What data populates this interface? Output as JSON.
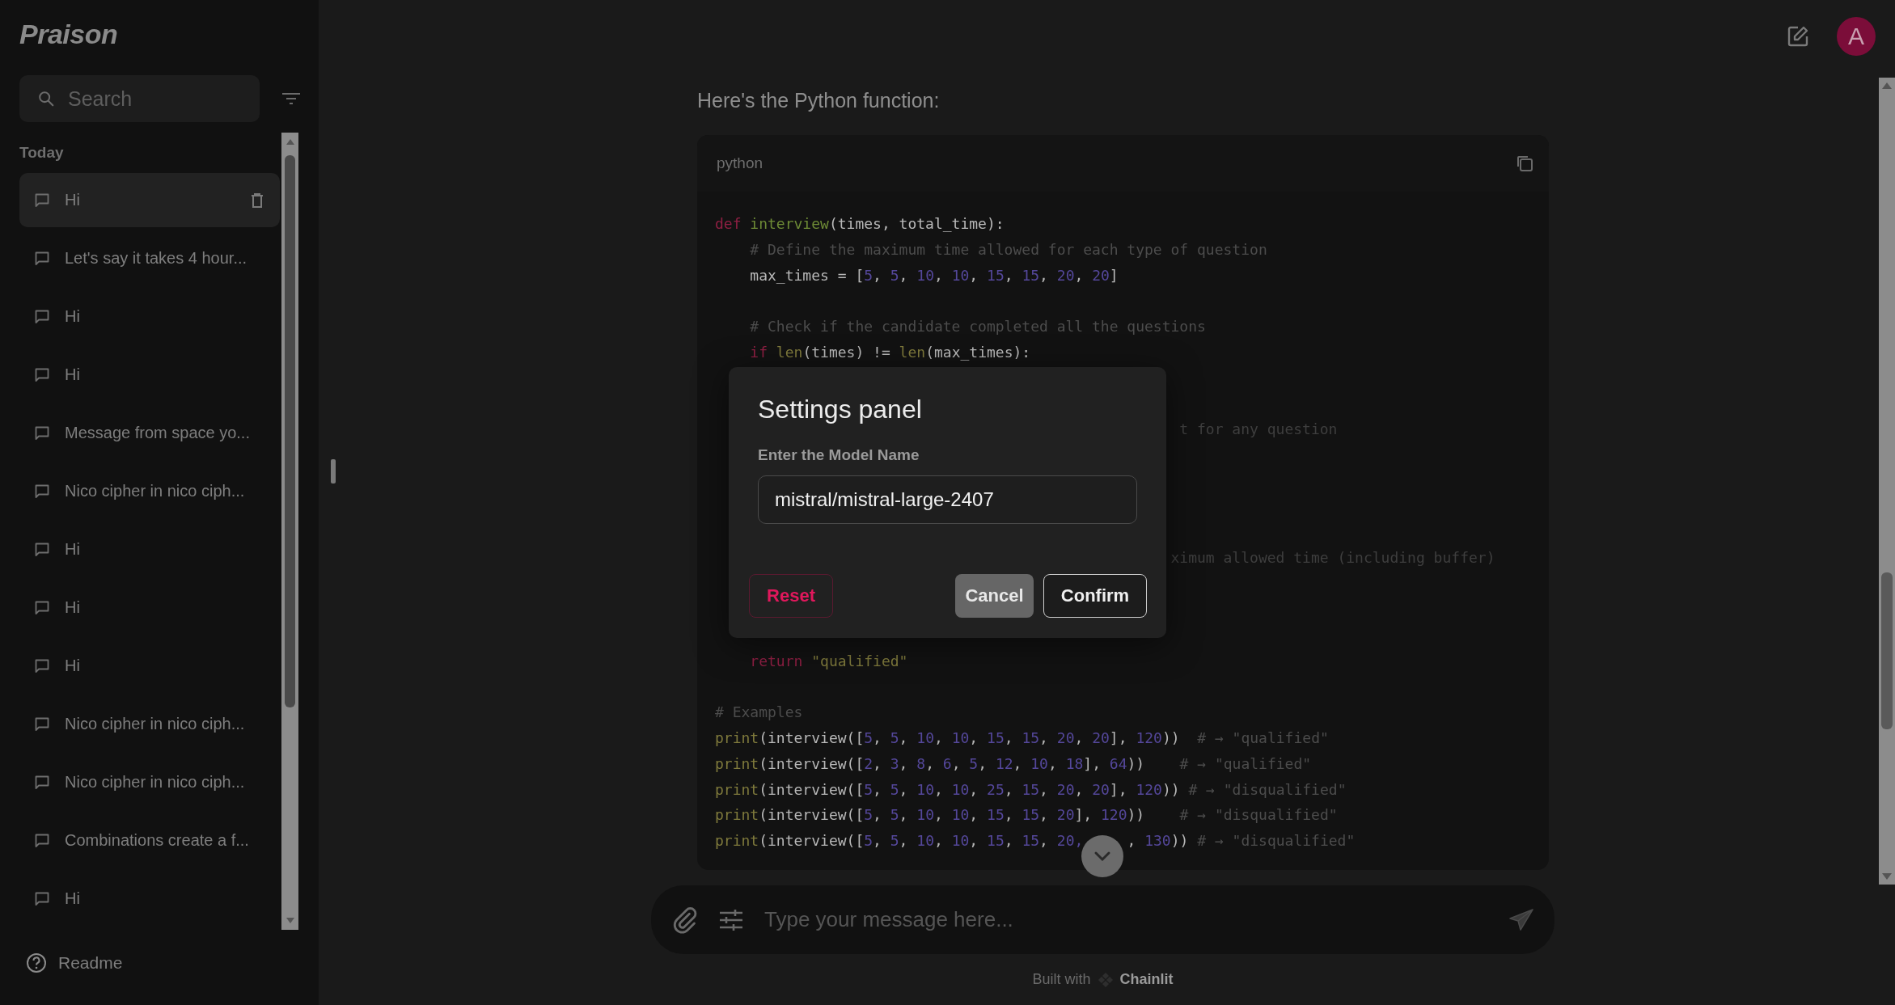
{
  "sidebar": {
    "logo": "Praison",
    "search": {
      "placeholder": "Search"
    },
    "group_label": "Today",
    "items": [
      {
        "label": "Hi",
        "selected": true
      },
      {
        "label": "Let's say it takes 4 hour...",
        "selected": false
      },
      {
        "label": "Hi",
        "selected": false
      },
      {
        "label": "Hi",
        "selected": false
      },
      {
        "label": "Message from space yo...",
        "selected": false
      },
      {
        "label": "Nico cipher in nico ciph...",
        "selected": false
      },
      {
        "label": "Hi",
        "selected": false
      },
      {
        "label": "Hi",
        "selected": false
      },
      {
        "label": "Hi",
        "selected": false
      },
      {
        "label": "Nico cipher in nico ciph...",
        "selected": false
      },
      {
        "label": "Nico cipher in nico ciph...",
        "selected": false
      },
      {
        "label": "Combinations create a f...",
        "selected": false
      },
      {
        "label": "Hi",
        "selected": false
      }
    ],
    "footer_link": "Readme"
  },
  "header": {
    "avatar": "A"
  },
  "message": {
    "text": "Here's the Python function:",
    "code": {
      "language": "python",
      "lines": [
        {
          "kind": "top",
          "tokens": [
            {
              "t": "def",
              "kind": "kw"
            },
            {
              "t": " interview",
              "kind": "fn"
            },
            {
              "t": "(times, total_time):",
              "kind": "plain"
            }
          ]
        },
        {
          "kind": "body",
          "tokens": [
            {
              "t": "# Define the maximum time allowed for each type of question",
              "kind": "cm"
            }
          ]
        },
        {
          "kind": "body",
          "tokens": [
            {
              "t": "max_times = [",
              "kind": "plain"
            },
            {
              "t": "5",
              "kind": "num"
            },
            {
              "t": ", ",
              "kind": "plain"
            },
            {
              "t": "5",
              "kind": "num"
            },
            {
              "t": ", ",
              "kind": "plain"
            },
            {
              "t": "10",
              "kind": "num"
            },
            {
              "t": ", ",
              "kind": "plain"
            },
            {
              "t": "10",
              "kind": "num"
            },
            {
              "t": ", ",
              "kind": "plain"
            },
            {
              "t": "15",
              "kind": "num"
            },
            {
              "t": ", ",
              "kind": "plain"
            },
            {
              "t": "15",
              "kind": "num"
            },
            {
              "t": ", ",
              "kind": "plain"
            },
            {
              "t": "20",
              "kind": "num"
            },
            {
              "t": ", ",
              "kind": "plain"
            },
            {
              "t": "20",
              "kind": "num"
            },
            {
              "t": "]",
              "kind": "plain"
            }
          ]
        },
        {
          "kind": "blank"
        },
        {
          "kind": "body",
          "tokens": [
            {
              "t": "# Check if the candidate completed all the questions",
              "kind": "cm"
            }
          ]
        },
        {
          "kind": "body",
          "tokens": [
            {
              "t": "if",
              "kind": "kw"
            },
            {
              "t": " len",
              "kind": "bi"
            },
            {
              "t": "(times) != ",
              "kind": "plain"
            },
            {
              "t": "len",
              "kind": "bi"
            },
            {
              "t": "(max_times):",
              "kind": "plain"
            }
          ]
        },
        {
          "kind": "blank"
        },
        {
          "kind": "blank"
        },
        {
          "kind": "partial",
          "tokens": [
            {
              "t": "t for any question",
              "kind": "cm"
            }
          ]
        },
        {
          "kind": "blank"
        },
        {
          "kind": "blank"
        },
        {
          "kind": "blank"
        },
        {
          "kind": "blank"
        },
        {
          "kind": "partial_wide",
          "tokens": [
            {
              "t": "ximum allowed time (including buffer)",
              "kind": "cm"
            }
          ]
        },
        {
          "kind": "blank"
        },
        {
          "kind": "blank"
        },
        {
          "kind": "blank"
        },
        {
          "kind": "body",
          "tokens": [
            {
              "t": "return",
              "kind": "kw"
            },
            {
              "t": " \"qualified\"",
              "kind": "str"
            }
          ]
        },
        {
          "kind": "blank"
        },
        {
          "kind": "top",
          "tokens": [
            {
              "t": "# Examples",
              "kind": "cm"
            }
          ]
        },
        {
          "kind": "top",
          "tokens": [
            {
              "t": "print",
              "kind": "bi"
            },
            {
              "t": "(interview([",
              "kind": "plain"
            },
            {
              "t": "5",
              "kind": "num"
            },
            {
              "t": ", ",
              "kind": "plain"
            },
            {
              "t": "5",
              "kind": "num"
            },
            {
              "t": ", ",
              "kind": "plain"
            },
            {
              "t": "10",
              "kind": "num"
            },
            {
              "t": ", ",
              "kind": "plain"
            },
            {
              "t": "10",
              "kind": "num"
            },
            {
              "t": ", ",
              "kind": "plain"
            },
            {
              "t": "15",
              "kind": "num"
            },
            {
              "t": ", ",
              "kind": "plain"
            },
            {
              "t": "15",
              "kind": "num"
            },
            {
              "t": ", ",
              "kind": "plain"
            },
            {
              "t": "20",
              "kind": "num"
            },
            {
              "t": ", ",
              "kind": "plain"
            },
            {
              "t": "20",
              "kind": "num"
            },
            {
              "t": "], ",
              "kind": "plain"
            },
            {
              "t": "120",
              "kind": "num"
            },
            {
              "t": "))  ",
              "kind": "plain"
            },
            {
              "t": "# → \"qualified\"",
              "kind": "cm"
            }
          ]
        },
        {
          "kind": "top",
          "tokens": [
            {
              "t": "print",
              "kind": "bi"
            },
            {
              "t": "(interview([",
              "kind": "plain"
            },
            {
              "t": "2",
              "kind": "num"
            },
            {
              "t": ", ",
              "kind": "plain"
            },
            {
              "t": "3",
              "kind": "num"
            },
            {
              "t": ", ",
              "kind": "plain"
            },
            {
              "t": "8",
              "kind": "num"
            },
            {
              "t": ", ",
              "kind": "plain"
            },
            {
              "t": "6",
              "kind": "num"
            },
            {
              "t": ", ",
              "kind": "plain"
            },
            {
              "t": "5",
              "kind": "num"
            },
            {
              "t": ", ",
              "kind": "plain"
            },
            {
              "t": "12",
              "kind": "num"
            },
            {
              "t": ", ",
              "kind": "plain"
            },
            {
              "t": "10",
              "kind": "num"
            },
            {
              "t": ", ",
              "kind": "plain"
            },
            {
              "t": "18",
              "kind": "num"
            },
            {
              "t": "], ",
              "kind": "plain"
            },
            {
              "t": "64",
              "kind": "num"
            },
            {
              "t": "))    ",
              "kind": "plain"
            },
            {
              "t": "# → \"qualified\"",
              "kind": "cm"
            }
          ]
        },
        {
          "kind": "top",
          "tokens": [
            {
              "t": "print",
              "kind": "bi"
            },
            {
              "t": "(interview([",
              "kind": "plain"
            },
            {
              "t": "5",
              "kind": "num"
            },
            {
              "t": ", ",
              "kind": "plain"
            },
            {
              "t": "5",
              "kind": "num"
            },
            {
              "t": ", ",
              "kind": "plain"
            },
            {
              "t": "10",
              "kind": "num"
            },
            {
              "t": ", ",
              "kind": "plain"
            },
            {
              "t": "10",
              "kind": "num"
            },
            {
              "t": ", ",
              "kind": "plain"
            },
            {
              "t": "25",
              "kind": "num"
            },
            {
              "t": ", ",
              "kind": "plain"
            },
            {
              "t": "15",
              "kind": "num"
            },
            {
              "t": ", ",
              "kind": "plain"
            },
            {
              "t": "20",
              "kind": "num"
            },
            {
              "t": ", ",
              "kind": "plain"
            },
            {
              "t": "20",
              "kind": "num"
            },
            {
              "t": "], ",
              "kind": "plain"
            },
            {
              "t": "120",
              "kind": "num"
            },
            {
              "t": ")) ",
              "kind": "plain"
            },
            {
              "t": "# → \"disqualified\"",
              "kind": "cm"
            }
          ]
        },
        {
          "kind": "top",
          "tokens": [
            {
              "t": "print",
              "kind": "bi"
            },
            {
              "t": "(interview([",
              "kind": "plain"
            },
            {
              "t": "5",
              "kind": "num"
            },
            {
              "t": ", ",
              "kind": "plain"
            },
            {
              "t": "5",
              "kind": "num"
            },
            {
              "t": ", ",
              "kind": "plain"
            },
            {
              "t": "10",
              "kind": "num"
            },
            {
              "t": ", ",
              "kind": "plain"
            },
            {
              "t": "10",
              "kind": "num"
            },
            {
              "t": ", ",
              "kind": "plain"
            },
            {
              "t": "15",
              "kind": "num"
            },
            {
              "t": ", ",
              "kind": "plain"
            },
            {
              "t": "15",
              "kind": "num"
            },
            {
              "t": ", ",
              "kind": "plain"
            },
            {
              "t": "20",
              "kind": "num"
            },
            {
              "t": "], ",
              "kind": "plain"
            },
            {
              "t": "120",
              "kind": "num"
            },
            {
              "t": "))    ",
              "kind": "plain"
            },
            {
              "t": "# → \"disqualified\"",
              "kind": "cm"
            }
          ]
        },
        {
          "kind": "top",
          "tokens": [
            {
              "t": "print",
              "kind": "bi"
            },
            {
              "t": "(interview([",
              "kind": "plain"
            },
            {
              "t": "5",
              "kind": "num"
            },
            {
              "t": ", ",
              "kind": "plain"
            },
            {
              "t": "5",
              "kind": "num"
            },
            {
              "t": ", ",
              "kind": "plain"
            },
            {
              "t": "10",
              "kind": "num"
            },
            {
              "t": ", ",
              "kind": "plain"
            },
            {
              "t": "10",
              "kind": "num"
            },
            {
              "t": ", ",
              "kind": "plain"
            },
            {
              "t": "15",
              "kind": "num"
            },
            {
              "t": ", ",
              "kind": "plain"
            },
            {
              "t": "15",
              "kind": "num"
            },
            {
              "t": ", ",
              "kind": "plain"
            },
            {
              "t": "20,",
              "kind": "num"
            },
            {
              "t": "     , ",
              "kind": "plain"
            },
            {
              "t": "130",
              "kind": "num"
            },
            {
              "t": ")) ",
              "kind": "plain"
            },
            {
              "t": "# → \"disqualified\"",
              "kind": "cm"
            }
          ]
        }
      ]
    }
  },
  "composer": {
    "placeholder": "Type your message here..."
  },
  "footer": {
    "prefix": "Built with",
    "brand": "Chainlit"
  },
  "dialog": {
    "title": "Settings panel",
    "field_label": "Enter the Model Name",
    "field_value": "mistral/mistral-large-2407",
    "buttons": [
      {
        "label": "Reset",
        "kind": "danger"
      },
      {
        "label": "Cancel",
        "kind": "filled"
      },
      {
        "label": "Confirm",
        "kind": "outline"
      }
    ]
  }
}
